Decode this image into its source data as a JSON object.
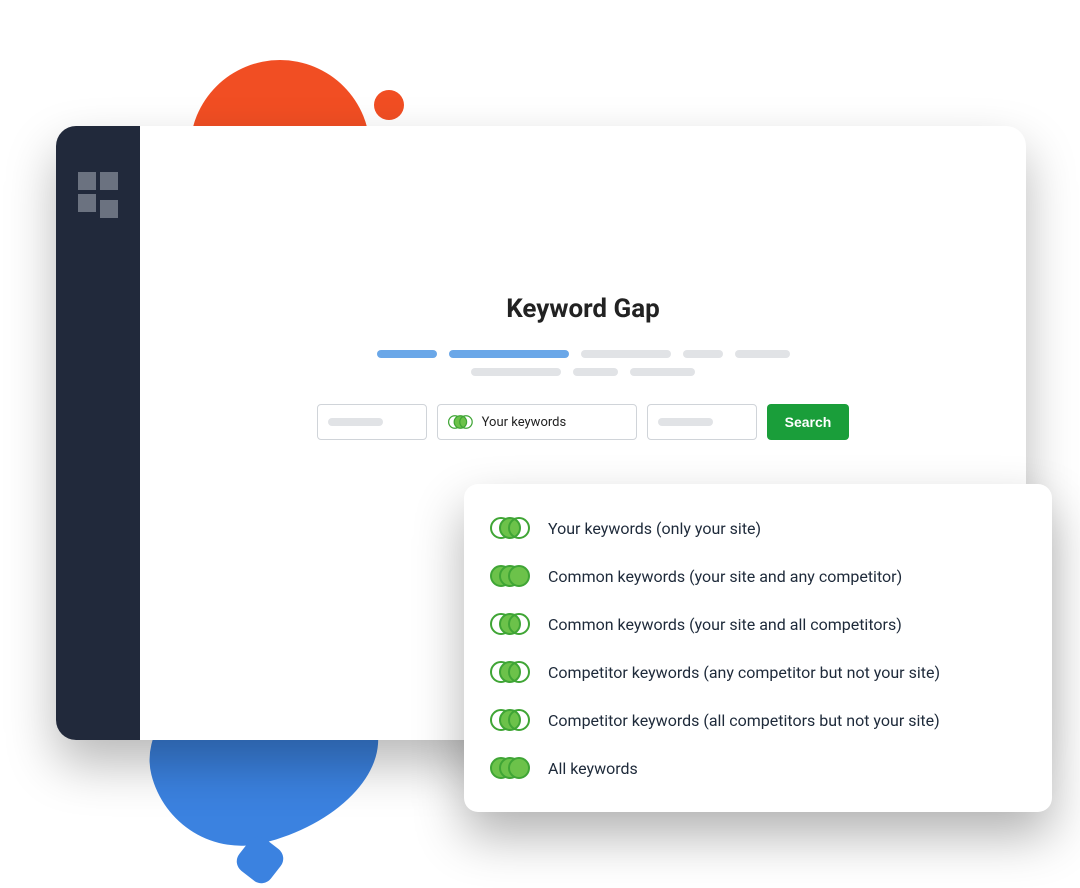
{
  "decor": {
    "orange_big": "#f14e23",
    "orange_small": "#f14e23",
    "blue_blob": "#3b82e0",
    "blue_small": "#3b82e0"
  },
  "page": {
    "title": "Keyword Gap"
  },
  "search": {
    "selected_filter_label": "Your keywords",
    "button_label": "Search"
  },
  "filters": [
    {
      "id": "your",
      "label": "Your keywords (only your site)",
      "fill": "M"
    },
    {
      "id": "common-any",
      "label": "Common keywords (your site and any competitor)",
      "fill": "LMR"
    },
    {
      "id": "common-all",
      "label": "Common keywords (your site and all competitors)",
      "fill": "M"
    },
    {
      "id": "competitor-any",
      "label": "Competitor keywords (any competitor but not your site)",
      "fill": "M"
    },
    {
      "id": "competitor-all",
      "label": "Competitor keywords (all competitors but not your site)",
      "fill": "M"
    },
    {
      "id": "all",
      "label": "All keywords",
      "fill": "LMR"
    }
  ]
}
